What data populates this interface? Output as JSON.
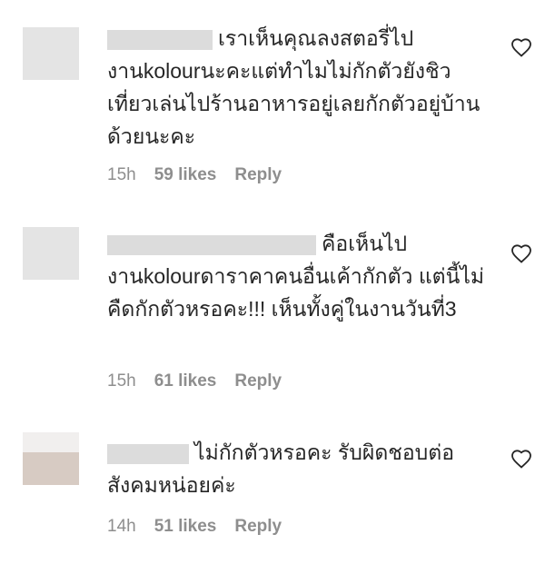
{
  "comments": [
    {
      "text": "เราเห็นคุณลงสตอรี่ไป งานkolourนะคะแต่ทำไมไม่กักตัวยังชิวเที่ยวเล่นไปร้านอาหารอยู่เลยกักตัวอยู่บ้านด้วยนะคะ",
      "time": "15h",
      "likes": "59 likes",
      "reply": "Reply"
    },
    {
      "text": "คือเห็นไป งานkolourดาราคาคนอื่นเค้ากักตัว แต่นี้ไม่คืดกักตัวหรอคะ!!! เห็นทั้งคู่ในงานวันที่3",
      "time": "15h",
      "likes": "61 likes",
      "reply": "Reply"
    },
    {
      "text": "ไม่กักตัวหรอคะ รับผิดชอบต่อสังคมหน่อยค่ะ",
      "time": "14h",
      "likes": "51 likes",
      "reply": "Reply"
    }
  ],
  "icons": {
    "like": "heart-outline-icon"
  }
}
